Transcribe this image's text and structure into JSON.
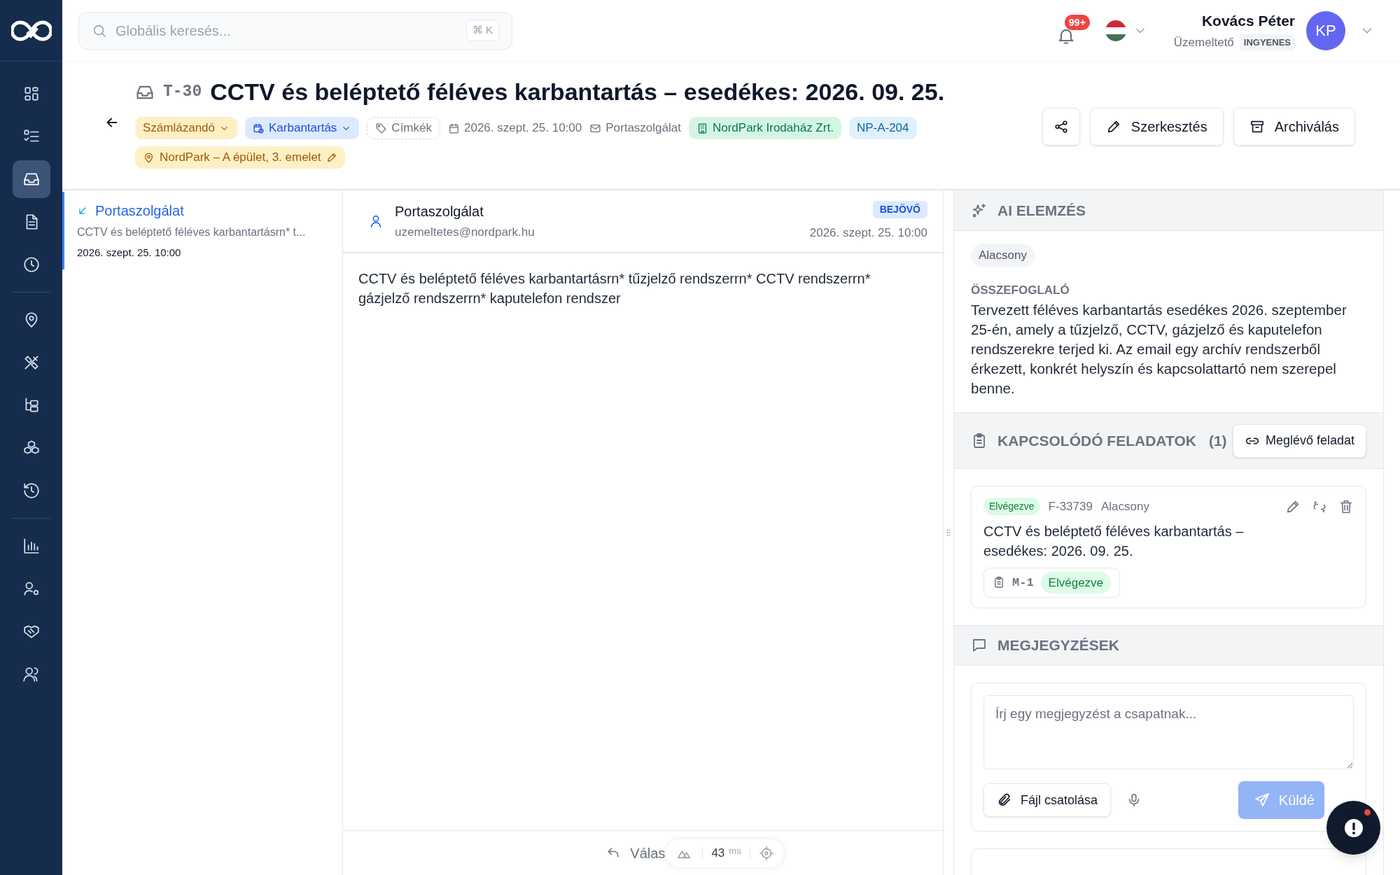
{
  "sidebar": {
    "sections": [
      {
        "items": [
          {
            "selected": false
          },
          {
            "selected": false
          },
          {
            "selected": true
          },
          {
            "selected": false
          },
          {
            "selected": false
          }
        ]
      },
      {
        "items": [
          {
            "selected": false
          },
          {
            "selected": false
          },
          {
            "selected": false
          },
          {
            "selected": false
          },
          {
            "selected": false
          }
        ]
      },
      {
        "items": [
          {
            "selected": false
          },
          {
            "selected": false
          },
          {
            "selected": false
          },
          {
            "selected": false
          }
        ]
      }
    ]
  },
  "topbar": {
    "search": {
      "placeholder": "Globális keresés...",
      "shortcut": "⌘ K"
    },
    "notifications": "99+",
    "user": {
      "name": "Kovács Péter",
      "role": "Üzemeltető",
      "plan": "INGYENES",
      "initials": "KP"
    }
  },
  "ticket": {
    "id": "T-30",
    "title": "CCTV és beléptető féléves karbantartás – esedékes: 2026. 09. 25.",
    "chips": [
      {
        "kind": "status",
        "label": "Számlázandó"
      },
      {
        "kind": "category",
        "label": "Karbantartás"
      },
      {
        "kind": "tags",
        "label": "Címkék"
      },
      {
        "kind": "date",
        "label": "2026. szept. 25. 10:00"
      },
      {
        "kind": "source",
        "label": "Portaszolgálat"
      },
      {
        "kind": "client",
        "label": "NordPark Irodaház Zrt."
      },
      {
        "kind": "code",
        "label": "NP-A-204"
      }
    ],
    "location": "NordPark – A épület, 3. emelet",
    "actions": [
      "Szerkesztés",
      "Archiválás"
    ]
  },
  "messages": [
    {
      "sender": "Portaszolgálat",
      "preview": "CCTV és beléptető féléves karbantartásrn* t...",
      "time": "2026. szept. 25. 10:00",
      "selected": true
    }
  ],
  "message": {
    "sender": "Portaszolgálat",
    "email": "uzemeltetes@nordpark.hu",
    "direction": "BEJÖVŐ",
    "time": "2026. szept. 25. 10:00",
    "body": "CCTV és beléptető féléves karbantartásrn* tűzjelző rendszerrn* CCTV rendszerrn* gázjelző rendszerrn* kaputelefon rendszer",
    "reply": "Válas"
  },
  "devtools": {
    "value": "43",
    "unit": "ms"
  },
  "ai": {
    "title": "AI ELEMZÉS",
    "priority": "Alacsony",
    "summary_label": "ÖSSZEFOGLALÓ",
    "summary": "Tervezett féléves karbantartás esedékes 2026. szeptember 25-én, amely a tűzjelző, CCTV, gázjelző és kaputelefon rendszerekre terjed ki. Az email egy archív rendszerből érkezett, konkrét helyszín és kapcsolattartó nem szerepel benne."
  },
  "related": {
    "title": "KAPCSOLÓDÓ FELADATOK",
    "count": "(1)",
    "button": "Meglévő feladat",
    "tasks": [
      {
        "status": "Elvégezve",
        "id": "F-33739",
        "priority": "Alacsony",
        "title": "CCTV és beléptető féléves karbantartás – esedékes: 2026. 09. 25.",
        "sub": {
          "id": "M-1",
          "status": "Elvégezve"
        }
      }
    ]
  },
  "notes": {
    "title": "MEGJEGYZÉSEK",
    "placeholder": "Írj egy megjegyzést a csapatnak...",
    "attach": "Fájl csatolása",
    "send": "Küldé"
  }
}
